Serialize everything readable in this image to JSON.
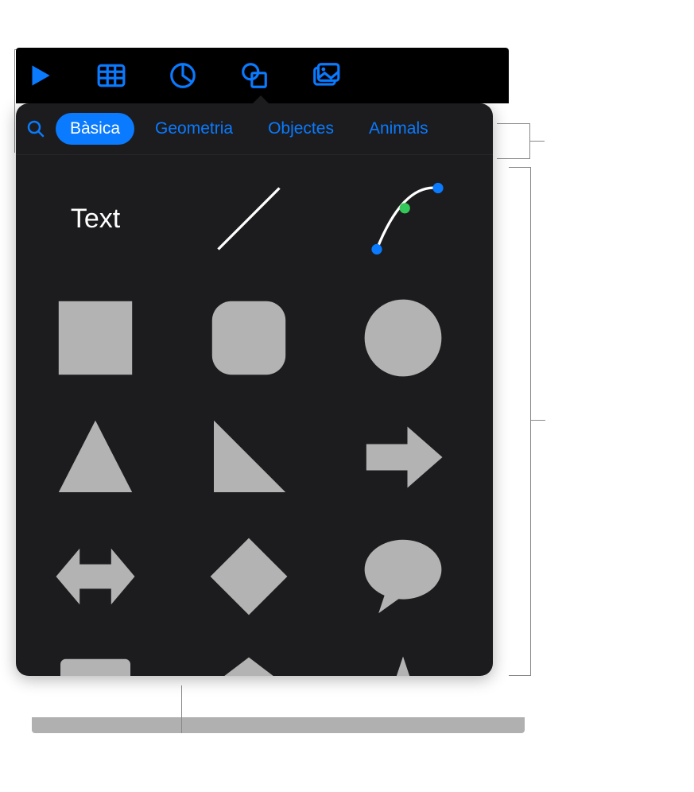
{
  "toolbar": {
    "icons": [
      "play",
      "table",
      "chart",
      "shapes",
      "media"
    ]
  },
  "popover": {
    "categories": [
      {
        "label": "Bàsica",
        "active": true
      },
      {
        "label": "Geometria",
        "active": false
      },
      {
        "label": "Objectes",
        "active": false
      },
      {
        "label": "Animals",
        "active": false
      }
    ],
    "shapes": {
      "text_label": "Text",
      "items": [
        "text",
        "line",
        "curve",
        "square",
        "rounded-square",
        "circle",
        "triangle",
        "right-triangle",
        "arrow-right",
        "double-arrow",
        "diamond",
        "speech-bubble",
        "callout-down",
        "pentagon",
        "star"
      ]
    }
  },
  "colors": {
    "accent": "#0a7aff",
    "shape_fill": "#b3b3b3",
    "bg_dark": "#1c1c1e",
    "node_blue": "#0a7aff",
    "node_green": "#34c759"
  }
}
